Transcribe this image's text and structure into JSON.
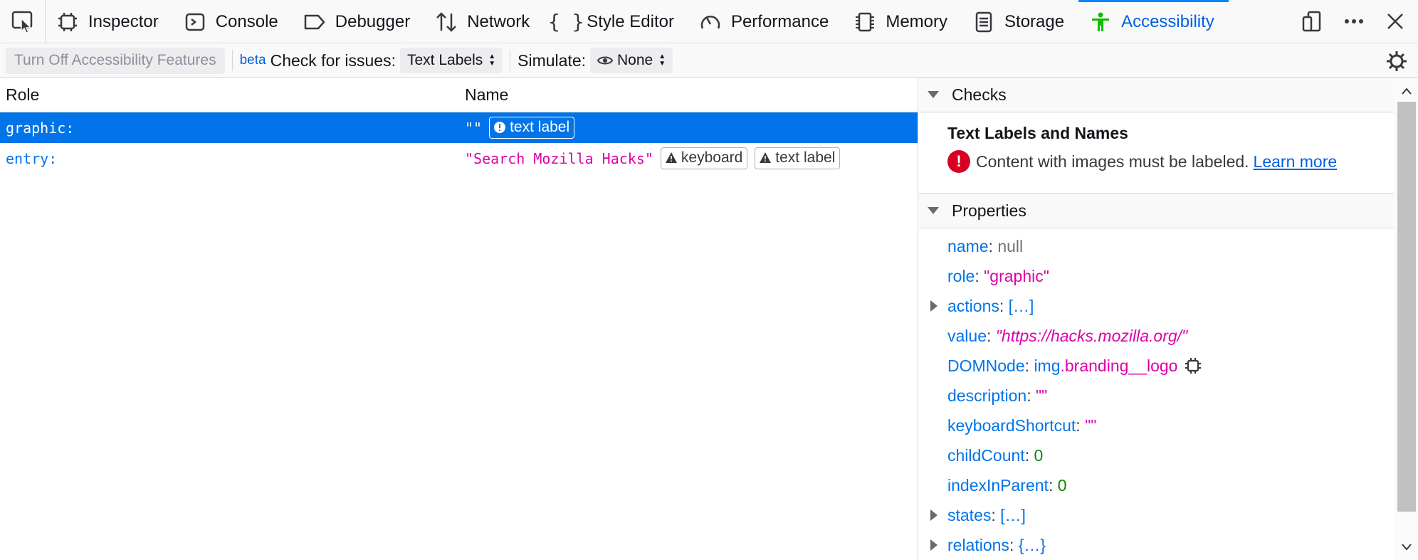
{
  "toolbar": {
    "tabs": [
      {
        "label": "Inspector",
        "icon": "inspector-icon"
      },
      {
        "label": "Console",
        "icon": "console-icon"
      },
      {
        "label": "Debugger",
        "icon": "debugger-icon"
      },
      {
        "label": "Network",
        "icon": "network-icon"
      },
      {
        "label": "Style Editor",
        "icon": "style-editor-icon"
      },
      {
        "label": "Performance",
        "icon": "performance-icon"
      },
      {
        "label": "Memory",
        "icon": "memory-icon"
      },
      {
        "label": "Storage",
        "icon": "storage-icon"
      },
      {
        "label": "Accessibility",
        "icon": "accessibility-icon"
      }
    ],
    "selected_tab": "Accessibility",
    "accent_color": "#0a84ff"
  },
  "toolbar2": {
    "turn_off_label": "Turn Off Accessibility Features",
    "beta_label": "beta",
    "check_label": "Check for issues:",
    "check_value": "Text Labels",
    "simulate_label": "Simulate:",
    "simulate_value": "None"
  },
  "tree": {
    "headers": {
      "role": "Role",
      "name": "Name"
    },
    "rows": [
      {
        "role": "graphic:",
        "name": "\"\"",
        "badges": [
          "text label"
        ],
        "selected": true
      },
      {
        "role": "entry:",
        "name": "\"Search Mozilla Hacks\"",
        "badges": [
          "keyboard",
          "text label"
        ],
        "selected": false
      }
    ]
  },
  "sidebar": {
    "checks_header": "Checks",
    "checks_title": "Text Labels and Names",
    "checks_message": "Content with images must be labeled.",
    "learn_more": "Learn more",
    "properties_header": "Properties",
    "props": {
      "name_key": "name",
      "name_val": "null",
      "role_key": "role",
      "role_val": "\"graphic\"",
      "actions_key": "actions",
      "actions_val": "[…]",
      "value_key": "value",
      "value_val": "\"https://hacks.mozilla.org/\"",
      "domnode_key": "DOMNode",
      "domnode_tag": "img",
      "domnode_class": ".branding__logo",
      "description_key": "description",
      "description_val": "\"\"",
      "keyboard_key": "keyboardShortcut",
      "keyboard_val": "\"\"",
      "childcount_key": "childCount",
      "childcount_val": "0",
      "index_key": "indexInParent",
      "index_val": "0",
      "states_key": "states",
      "states_val": "[…]",
      "relations_key": "relations",
      "relations_val": "{…}"
    }
  },
  "colors": {
    "selection": "#0074e8",
    "error": "#d70022",
    "string": "#dd00a9",
    "number": "#058b00"
  }
}
